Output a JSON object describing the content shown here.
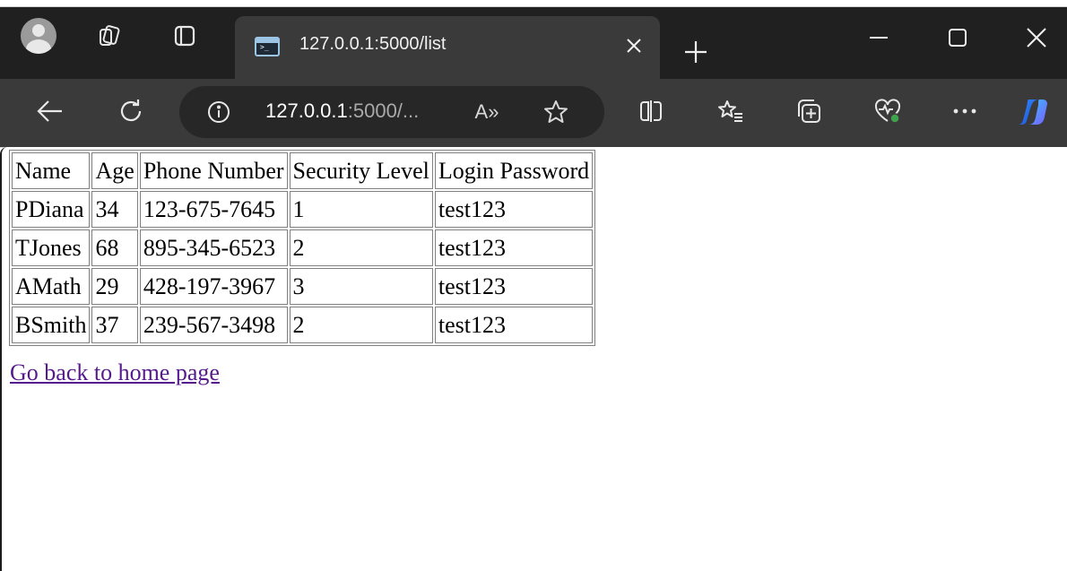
{
  "browser": {
    "tab": {
      "title": "127.0.0.1:5000/list",
      "favicon_prompt": ">_"
    },
    "address_bar": {
      "url_host": "127.0.0.1",
      "url_rest": ":5000/...",
      "read_aloud_label": "A»"
    },
    "icons": {
      "profile": "avatar-icon",
      "workspaces": "workspaces-icon",
      "tab_actions": "tab-actions-icon",
      "close_tab": "close-icon",
      "new_tab": "plus-icon",
      "minimize": "minimize-icon",
      "maximize": "maximize-icon",
      "close_window": "close-icon",
      "back": "back-arrow-icon",
      "refresh": "refresh-icon",
      "site_info": "info-icon",
      "favorite": "star-icon",
      "split_screen": "split-screen-icon",
      "favorites": "favorites-icon",
      "collections": "collections-icon",
      "browser_essentials": "heartbeat-icon",
      "more": "more-icon",
      "copilot": "copilot-icon"
    },
    "colors": {
      "titlebar": "#202020",
      "toolbar": "#3a3a3a",
      "omnibox": "#272727",
      "visited_link": "#551a8b"
    }
  },
  "page": {
    "table": {
      "headers": [
        "Name",
        "Age",
        "Phone Number",
        "Security Level",
        "Login Password"
      ],
      "rows": [
        [
          "PDiana",
          "34",
          "123-675-7645",
          "1",
          "test123"
        ],
        [
          "TJones",
          "68",
          "895-345-6523",
          "2",
          "test123"
        ],
        [
          "AMath",
          "29",
          "428-197-3967",
          "3",
          "test123"
        ],
        [
          "BSmith",
          "37",
          "239-567-3498",
          "2",
          "test123"
        ]
      ]
    },
    "home_link": "Go back to home page"
  }
}
